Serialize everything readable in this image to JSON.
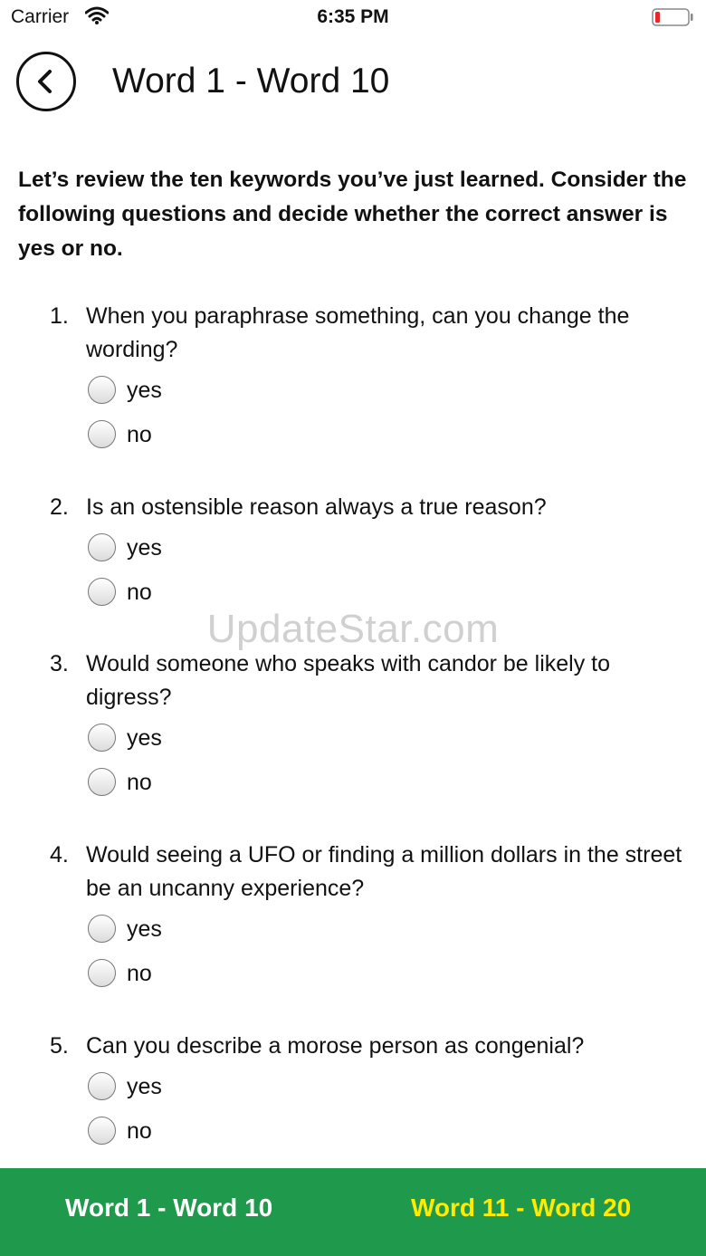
{
  "status": {
    "carrier": "Carrier",
    "time": "6:35 PM",
    "battery_color": "#e8262b"
  },
  "nav": {
    "title": "Word 1 - Word 10"
  },
  "intro": "Let’s review the ten keywords you’ve just learned. Consider the following questions and decide whether the correct answer is yes or no.",
  "questions": [
    {
      "number": "1.",
      "text": "When you paraphrase something, can you change the wording?",
      "options": [
        "yes",
        "no"
      ]
    },
    {
      "number": "2.",
      "text": "Is an ostensible reason always a true reason?",
      "options": [
        "yes",
        "no"
      ]
    },
    {
      "number": "3.",
      "text": "Would someone who speaks with candor be likely to digress?",
      "options": [
        "yes",
        "no"
      ]
    },
    {
      "number": "4.",
      "text": "Would seeing a UFO or finding a million dollars in the street be an uncanny experience?",
      "options": [
        "yes",
        "no"
      ]
    },
    {
      "number": "5.",
      "text": "Can you describe a morose person as congenial?",
      "options": [
        "yes",
        "no"
      ]
    }
  ],
  "watermark": "UpdateStar.com",
  "bottom_nav": {
    "current": "Word 1 - Word 10",
    "next": "Word 11 - Word 20",
    "bar_color": "#1f9a4c",
    "next_color": "#ffea00"
  }
}
